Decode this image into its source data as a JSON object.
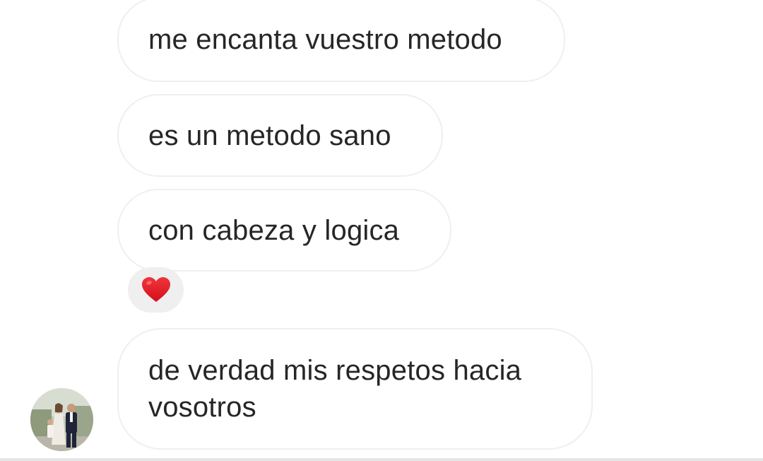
{
  "messages": [
    {
      "text": "me encanta vuestro metodo"
    },
    {
      "text": "es un metodo sano"
    },
    {
      "text": "con cabeza y logica",
      "reaction": {
        "icon": "red-heart-icon",
        "color": "#e0141f"
      }
    },
    {
      "text": "de verdad mis respetos hacia vosotros"
    }
  ],
  "sender": {
    "avatar": "profile-photo"
  },
  "colors": {
    "bubble_border": "#efefef",
    "reaction_bg": "#efefef",
    "text": "#262626",
    "background": "#ffffff"
  }
}
